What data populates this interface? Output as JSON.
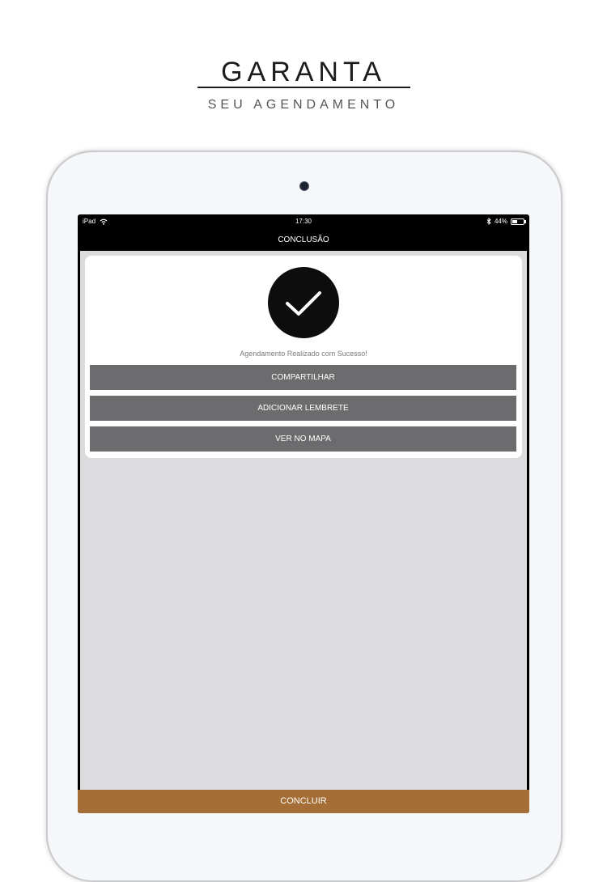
{
  "promo": {
    "title": "GARANTA",
    "subtitle": "SEU AGENDAMENTO"
  },
  "status_bar": {
    "device": "iPad",
    "time": "17:30",
    "battery": "44%",
    "battery_level": 0.44,
    "icons": [
      "wifi-icon",
      "bluetooth-icon",
      "battery-icon"
    ]
  },
  "nav": {
    "title": "CONCLUSÃO"
  },
  "success": {
    "icon": "checkmark-icon",
    "message": "Agendamento Realizado com Sucesso!"
  },
  "actions": [
    {
      "label": "COMPARTILHAR"
    },
    {
      "label": "ADICIONAR LEMBRETE"
    },
    {
      "label": "VER NO MAPA"
    }
  ],
  "footer": {
    "conclude_label": "CONCLUIR"
  },
  "colors": {
    "nav_background": "#000000",
    "content_background": "#dcdcde",
    "action_button": "#6c6c6e",
    "conclude_button": "#a56e36"
  }
}
